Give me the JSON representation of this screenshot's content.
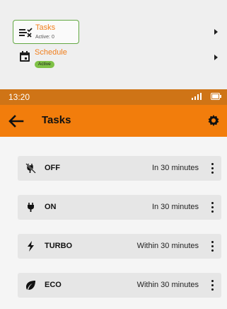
{
  "menu": {
    "tasks": {
      "title": "Tasks",
      "subtitle": "Active: 0"
    },
    "schedule": {
      "title": "Schedule",
      "badge": "Active"
    }
  },
  "status_bar": {
    "time": "13:20"
  },
  "app_bar": {
    "title": "Tasks"
  },
  "tasks": [
    {
      "label": "OFF",
      "time": "In 30 minutes",
      "icon": "plug-off-icon"
    },
    {
      "label": "ON",
      "time": "In 30 minutes",
      "icon": "plug-icon"
    },
    {
      "label": "TURBO",
      "time": "Within 30 minutes",
      "icon": "lightning-icon"
    },
    {
      "label": "ECO",
      "time": "Within 30 minutes",
      "icon": "leaf-icon"
    }
  ],
  "colors": {
    "accent_orange": "#f27d0c",
    "status_bar_orange": "#cf7416",
    "active_green": "#7fc146",
    "card_background": "#e6e6e6"
  }
}
